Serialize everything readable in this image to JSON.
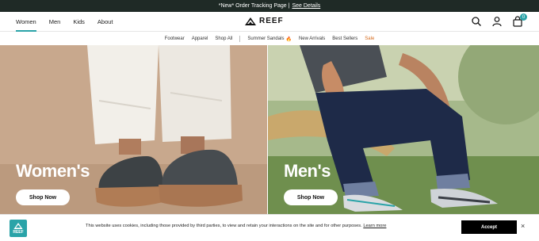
{
  "announcement": {
    "text": "*New* Order Tracking Page |",
    "link": "See Details"
  },
  "header": {
    "nav": [
      {
        "label": "Women",
        "active": true
      },
      {
        "label": "Men",
        "active": false
      },
      {
        "label": "Kids",
        "active": false
      },
      {
        "label": "About",
        "active": false
      }
    ],
    "logo_text": "REEF",
    "cart_count": "0",
    "icons": [
      "search-icon",
      "account-icon",
      "cart-icon"
    ]
  },
  "subnav": {
    "items": [
      "Footwear",
      "Apparel",
      "Shop All"
    ],
    "items2": [
      "Summer Sandals",
      "New Arrivals",
      "Best Sellers",
      "Sale"
    ],
    "emoji": "🔥"
  },
  "hero": {
    "left": {
      "title": "Women's",
      "button": "Shop Now"
    },
    "right": {
      "title": "Men's",
      "button": "Shop Now"
    }
  },
  "cookie": {
    "logo_text": "REEF",
    "text": "This website uses cookies, including those provided by third parties, to view and retain your interactions on the site and for other purposes.",
    "link": "Learn more",
    "accept": "Accept",
    "close": "×"
  },
  "colors": {
    "accent": "#2aa3a8",
    "announcement_bg": "#1f2a26",
    "sale": "#d46a1b"
  }
}
